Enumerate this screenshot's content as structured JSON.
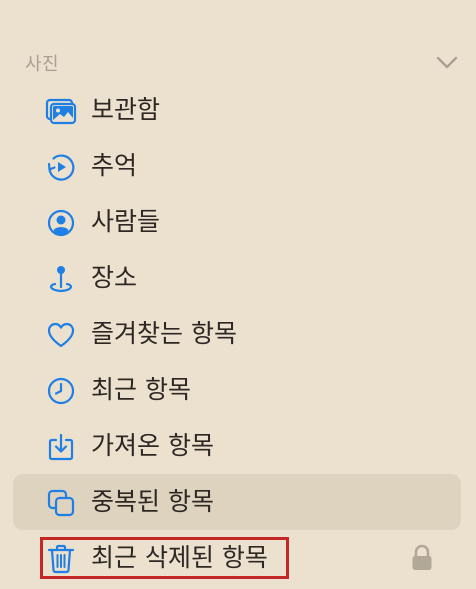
{
  "section": {
    "title": "사진"
  },
  "sidebar": {
    "items": [
      {
        "label": "보관함",
        "icon": "photo-library-icon"
      },
      {
        "label": "추억",
        "icon": "memories-icon"
      },
      {
        "label": "사람들",
        "icon": "people-icon"
      },
      {
        "label": "장소",
        "icon": "places-icon"
      },
      {
        "label": "즐겨찾는 항목",
        "icon": "favorites-icon"
      },
      {
        "label": "최근 항목",
        "icon": "recents-icon"
      },
      {
        "label": "가져온 항목",
        "icon": "imports-icon"
      },
      {
        "label": "중복된 항목",
        "icon": "duplicates-icon"
      },
      {
        "label": "최근 삭제된 항목",
        "icon": "trash-icon"
      }
    ]
  },
  "colors": {
    "background": "#ebe1ce",
    "selected_background": "#ddd3bf",
    "icon_blue": "#1f7fe5",
    "highlight_red": "#c52626"
  }
}
